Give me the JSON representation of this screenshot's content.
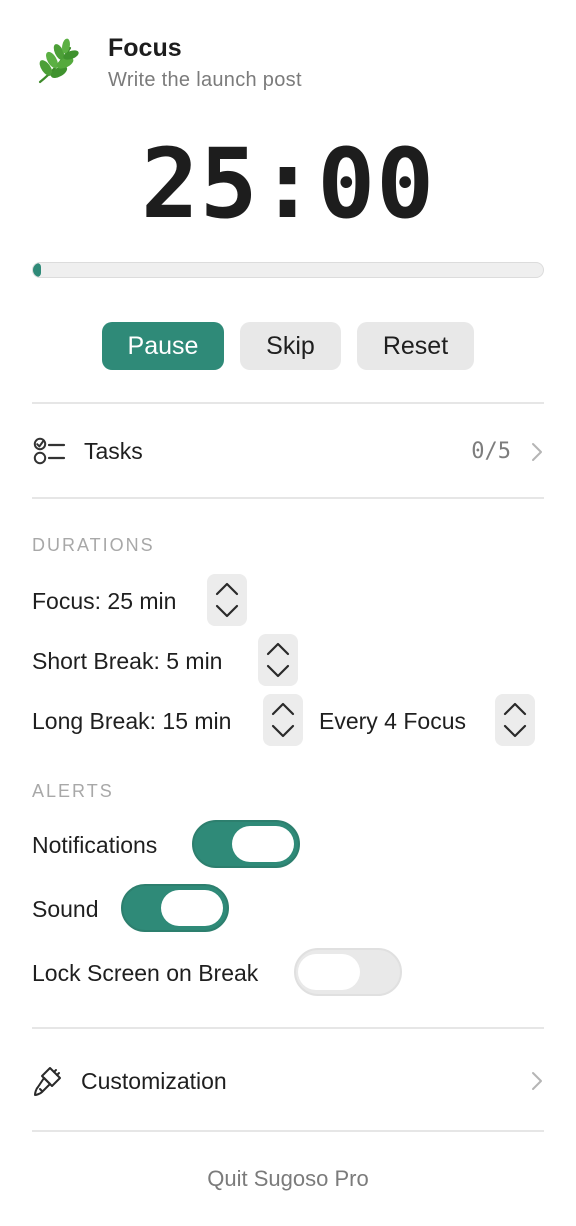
{
  "header": {
    "title": "Focus",
    "subtitle": "Write the launch post",
    "icon": "leaf-sprig-icon"
  },
  "timer": {
    "display": "25:00",
    "progress_fraction": 0.01
  },
  "controls": {
    "pause_label": "Pause",
    "skip_label": "Skip",
    "reset_label": "Reset"
  },
  "tasks": {
    "label": "Tasks",
    "count": "0/5",
    "icon": "checklist-icon"
  },
  "durations": {
    "header": "DURATIONS",
    "focus_label": "Focus: 25 min",
    "short_break_label": "Short Break: 5 min",
    "long_break_label": "Long Break: 15 min",
    "long_break_every_label": "Every 4 Focus"
  },
  "alerts": {
    "header": "ALERTS",
    "notifications": {
      "label": "Notifications",
      "on": true
    },
    "sound": {
      "label": "Sound",
      "on": true
    },
    "lock_screen": {
      "label": "Lock Screen on Break",
      "on": false
    }
  },
  "customization": {
    "label": "Customization",
    "icon": "paintbrush-icon"
  },
  "footer": {
    "quit_label": "Quit Sugoso Pro"
  },
  "colors": {
    "accent": "#2f8a78",
    "button_secondary": "#e8e8e8",
    "divider": "#e6e6e6",
    "muted_text": "#7b7b7b",
    "section_header": "#a8a8a8"
  }
}
